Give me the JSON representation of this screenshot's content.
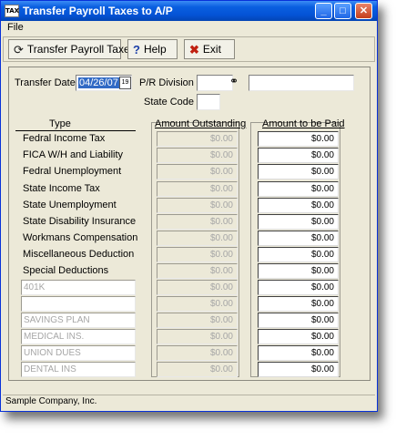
{
  "window": {
    "title": "Transfer Payroll Taxes to A/P",
    "icon_text": "TAX"
  },
  "menu": {
    "file": "File"
  },
  "toolbar": {
    "transfer_label": "Transfer Payroll Taxes",
    "help_label": "Help",
    "exit_label": "Exit"
  },
  "form": {
    "transfer_date_label": "Transfer Date :",
    "transfer_date_value": "04/26/07",
    "division_label": "P/R Division :",
    "division_code": "",
    "division_name": "",
    "state_code_label": "State Code :",
    "state_code_value": ""
  },
  "columns": {
    "type": "Type",
    "outstanding": "Amount Outstanding",
    "paid": "Amount to be Paid"
  },
  "rows": [
    {
      "type": "Fedral Income Tax",
      "outstanding": "$0.00",
      "paid": "$0.00"
    },
    {
      "type": "FICA W/H and Liability",
      "outstanding": "$0.00",
      "paid": "$0.00"
    },
    {
      "type": "Fedral Unemployment",
      "outstanding": "$0.00",
      "paid": "$0.00"
    },
    {
      "type": "State Income Tax",
      "outstanding": "$0.00",
      "paid": "$0.00"
    },
    {
      "type": "State Unemployment",
      "outstanding": "$0.00",
      "paid": "$0.00"
    },
    {
      "type": "State Disability Insurance",
      "outstanding": "$0.00",
      "paid": "$0.00"
    },
    {
      "type": "Workmans Compensation",
      "outstanding": "$0.00",
      "paid": "$0.00"
    },
    {
      "type": "Miscellaneous Deduction",
      "outstanding": "$0.00",
      "paid": "$0.00"
    },
    {
      "type": "Special Deductions",
      "outstanding": "$0.00",
      "paid": "$0.00"
    },
    {
      "type": "401K",
      "outstanding": "$0.00",
      "paid": "$0.00"
    },
    {
      "type": "",
      "outstanding": "$0.00",
      "paid": "$0.00"
    },
    {
      "type": "SAVINGS PLAN",
      "outstanding": "$0.00",
      "paid": "$0.00"
    },
    {
      "type": "MEDICAL INS.",
      "outstanding": "$0.00",
      "paid": "$0.00"
    },
    {
      "type": "UNION DUES",
      "outstanding": "$0.00",
      "paid": "$0.00"
    },
    {
      "type": "DENTAL INS",
      "outstanding": "$0.00",
      "paid": "$0.00"
    }
  ],
  "status": {
    "company": "Sample Company, Inc."
  },
  "icons": {
    "transfer": "refresh-icon",
    "help": "question-icon",
    "exit": "x-icon",
    "calendar": "calendar-icon",
    "lookup": "binoculars-icon"
  }
}
